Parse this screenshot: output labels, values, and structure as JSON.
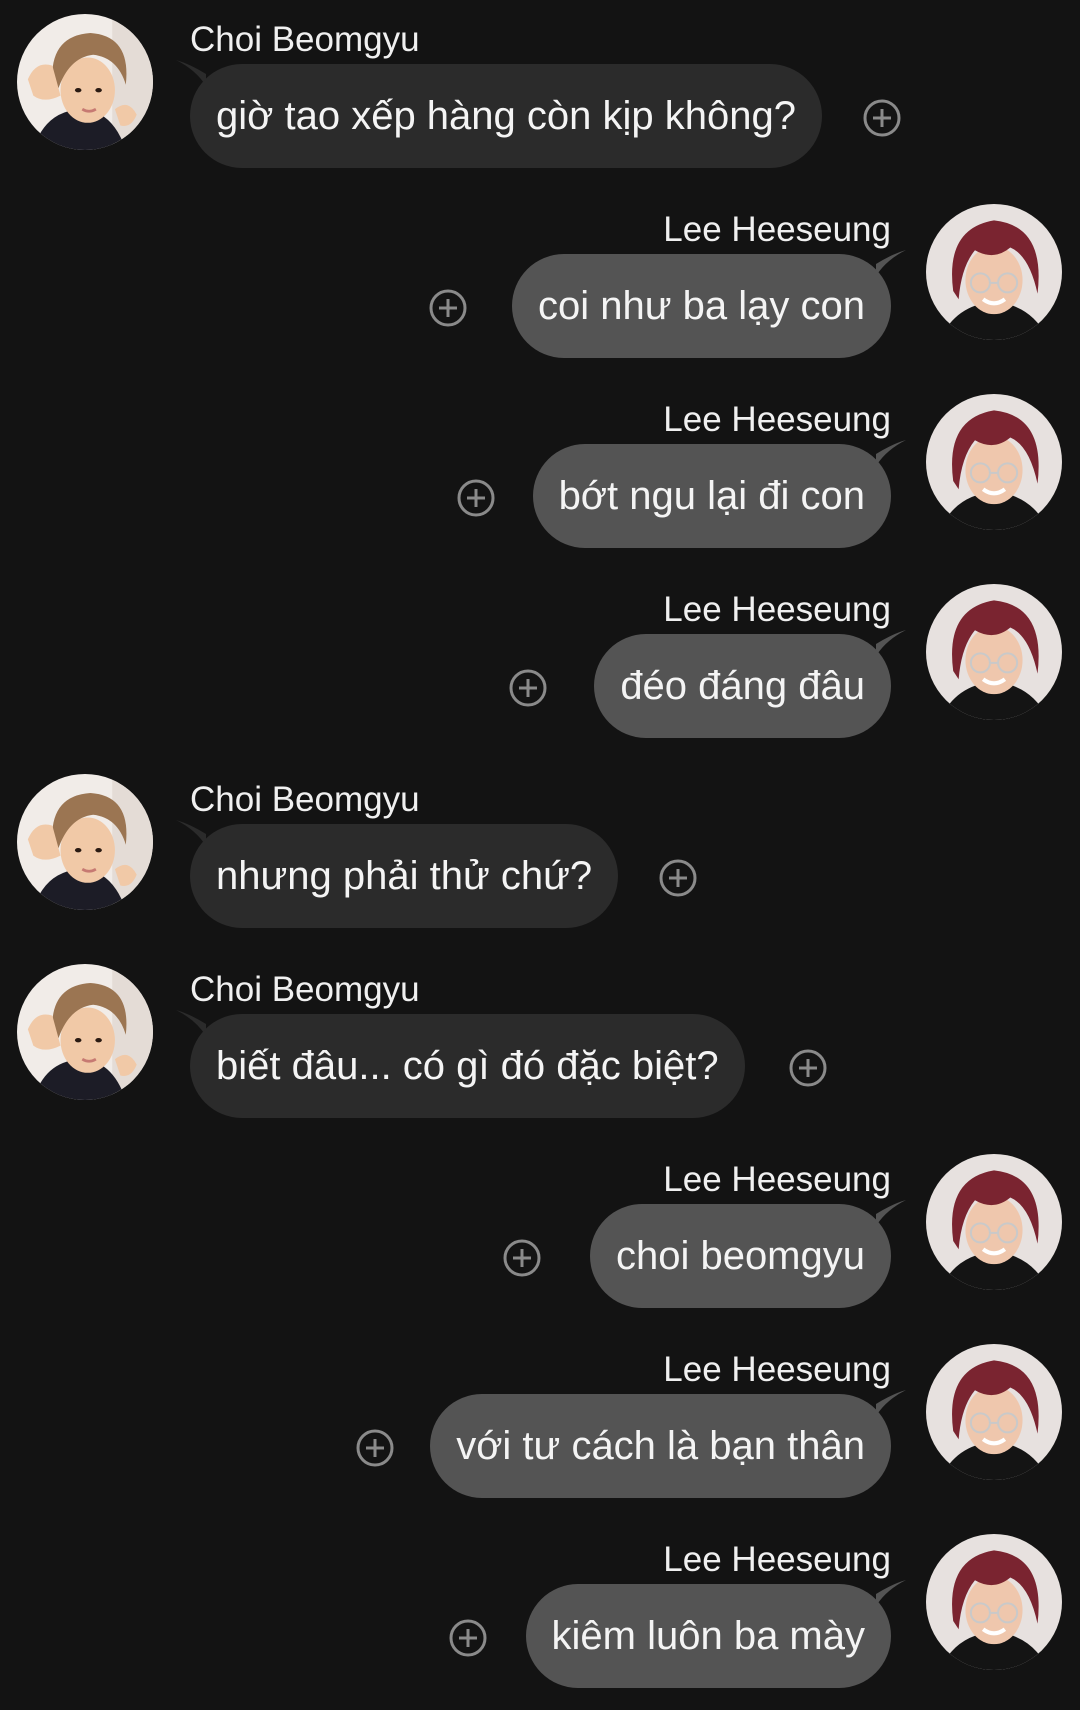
{
  "colors": {
    "background": "#131313",
    "incoming_bubble": "#2b2b2b",
    "outgoing_bubble": "#545454",
    "react_icon": "#8a8a8a"
  },
  "icons": {
    "react": "add-reaction-icon",
    "avatar_beomgyu": "avatar-choi-beomgyu",
    "avatar_heeseung": "avatar-lee-heeseung"
  },
  "messages": [
    {
      "sender": "Choi Beomgyu",
      "text": "giờ tao xếp hàng còn kịp không?"
    },
    {
      "sender": "Lee Heeseung",
      "text": "coi như ba lạy con"
    },
    {
      "sender": "Lee Heeseung",
      "text": "bớt ngu lại đi con"
    },
    {
      "sender": "Lee Heeseung",
      "text": "đéo đáng đâu"
    },
    {
      "sender": "Choi Beomgyu",
      "text": "nhưng phải thử chứ?"
    },
    {
      "sender": "Choi Beomgyu",
      "text": "biết đâu... có gì đó đặc biệt?"
    },
    {
      "sender": "Lee Heeseung",
      "text": "choi beomgyu"
    },
    {
      "sender": "Lee Heeseung",
      "text": "với tư cách là bạn thân"
    },
    {
      "sender": "Lee Heeseung",
      "text": "kiêm luôn ba mày"
    }
  ]
}
